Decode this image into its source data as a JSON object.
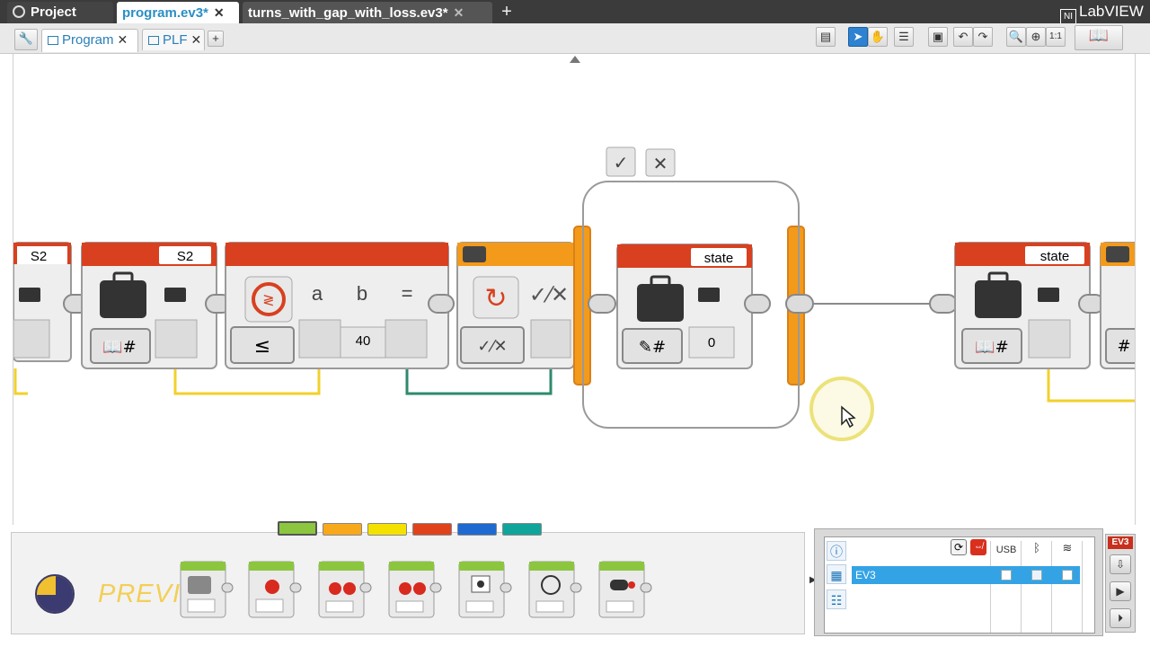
{
  "top_tabs": [
    {
      "label": "Project",
      "active": false
    },
    {
      "label": "program.ev3*",
      "active": true
    },
    {
      "label": "turns_with_gap_with_loss.ev3*",
      "active": false
    }
  ],
  "brand": {
    "name": "LabVIEW"
  },
  "sub_tabs": [
    {
      "label": "Program",
      "active": true
    },
    {
      "label": "PLF",
      "active": false
    }
  ],
  "blocks": {
    "port_s2_left": "S2",
    "port_s2": "S2",
    "compare_a": "a",
    "compare_b": "b",
    "compare_op": "=",
    "compare_value": "40",
    "var_state_1": "state",
    "var_state_1_value": "0",
    "var_state_2": "state"
  },
  "palette": {
    "preview_label": "PREVIEW",
    "category_colors": [
      "#8cc63f",
      "#f7a81b",
      "#f4e100",
      "#e0431c",
      "#1f6ad1",
      "#10a59a"
    ]
  },
  "hardware": {
    "columns": [
      "USB"
    ],
    "brick_name": "EV3",
    "panel_label": "EV3"
  },
  "colors": {
    "accent_blue": "#2a8fc4",
    "block_red": "#d8401f",
    "block_orange": "#f39a1a",
    "wire_yellow": "#f2d02b",
    "wire_green": "#2e8a6e"
  }
}
